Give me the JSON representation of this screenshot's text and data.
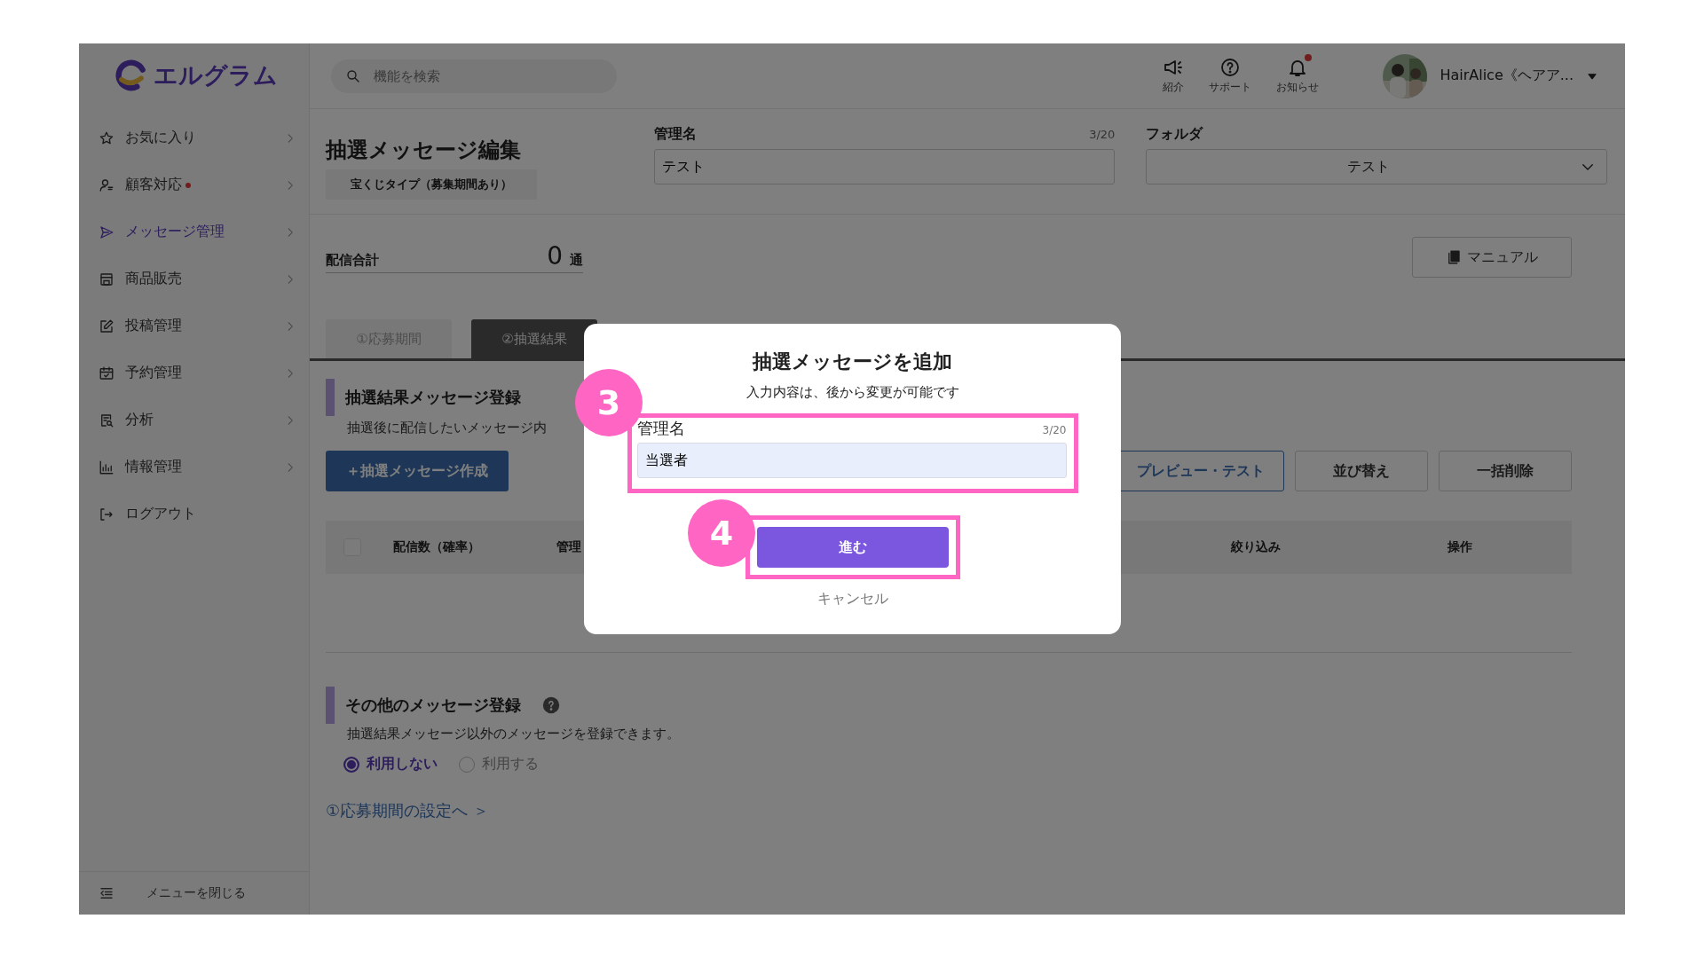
{
  "sidebar": {
    "logo": "エルグラム",
    "items": [
      {
        "kind": "star",
        "label": "お気に入り",
        "selected": false,
        "alert": false,
        "chevron": true
      },
      {
        "kind": "person",
        "label": "顧客対応",
        "selected": false,
        "alert": true,
        "chevron": true
      },
      {
        "kind": "send",
        "label": "メッセージ管理",
        "selected": true,
        "alert": false,
        "chevron": true
      },
      {
        "kind": "store",
        "label": "商品販売",
        "selected": false,
        "alert": false,
        "chevron": true
      },
      {
        "kind": "edit",
        "label": "投稿管理",
        "selected": false,
        "alert": false,
        "chevron": true
      },
      {
        "kind": "calendar",
        "label": "予約管理",
        "selected": false,
        "alert": false,
        "chevron": true
      },
      {
        "kind": "report",
        "label": "分析",
        "selected": false,
        "alert": false,
        "chevron": true
      },
      {
        "kind": "chart",
        "label": "情報管理",
        "selected": false,
        "alert": false,
        "chevron": true
      },
      {
        "kind": "logout",
        "label": "ログアウト",
        "selected": false,
        "alert": false,
        "chevron": false
      }
    ],
    "footer": "メニューを閉じる"
  },
  "header": {
    "search": {
      "placeholder": "機能を検索"
    },
    "icons": [
      {
        "kind": "megaphone",
        "label": "紹介",
        "alert": false
      },
      {
        "kind": "help",
        "label": "サポート",
        "alert": false
      },
      {
        "kind": "bell",
        "label": "お知らせ",
        "alert": true
      }
    ],
    "account": {
      "name": "HairAlice《ヘアア..."
    }
  },
  "main": {
    "title": "抽選メッセージ編集",
    "type_badge": "宝くじタイプ（募集期間あり）",
    "name_field": {
      "label": "管理名",
      "counter": "3/20",
      "value": "テスト"
    },
    "folder_select": {
      "label": "フォルダ",
      "value": "テスト"
    },
    "total": {
      "label": "配信合計",
      "value": "0",
      "unit": "通"
    },
    "manual_button": "マニュアル",
    "tabs": [
      {
        "label": "①応募期間",
        "selected": false
      },
      {
        "label": "②抽選結果",
        "selected": true
      }
    ],
    "result_section": {
      "title": "抽選結果メッセージ登録",
      "description": "抽選後に配信したいメッセージ内",
      "create_button": "＋抽選メッセージ作成",
      "actions": [
        {
          "label": "プレビュー・テスト",
          "kind": "outline"
        },
        {
          "label": "並び替え",
          "kind": "plain"
        },
        {
          "label": "一括削除",
          "kind": "plain"
        }
      ],
      "table": {
        "select_all": {
          "checked": false
        },
        "columns": [
          "配信数（確率）",
          "管理",
          "絞り込み",
          "操作"
        ]
      }
    },
    "other_section": {
      "title": "その他のメッセージ登録",
      "help": true,
      "description": "抽選結果メッセージ以外のメッセージを登録できます。",
      "options": [
        {
          "label": "利用しない",
          "selected": true
        },
        {
          "label": "利用する",
          "selected": false
        }
      ],
      "link": "①応募期間の設定へ ＞"
    }
  },
  "modal": {
    "title": "抽選メッセージを追加",
    "subtitle": "入力内容は、後から変更が可能です",
    "field": {
      "label": "管理名",
      "counter": "3/20",
      "value": "当選者"
    },
    "primary_button": "進む",
    "cancel": "キャンセル",
    "steps": [
      "3",
      "4"
    ]
  }
}
